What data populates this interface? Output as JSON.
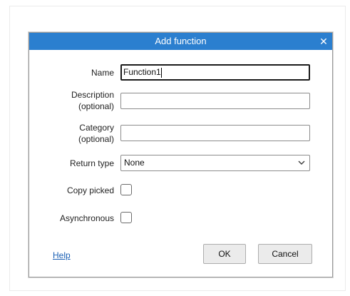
{
  "dialog": {
    "title": "Add function",
    "close_glyph": "✕"
  },
  "form": {
    "name_label": "Name",
    "name_value": "Function1",
    "description_label_line1": "Description",
    "description_label_line2": "(optional)",
    "description_value": "",
    "category_label_line1": "Category",
    "category_label_line2": "(optional)",
    "category_value": "",
    "return_type_label": "Return type",
    "return_type_value": "None",
    "copy_picked_label": "Copy picked",
    "copy_picked_checked": false,
    "asynchronous_label": "Asynchronous",
    "asynchronous_checked": false
  },
  "footer": {
    "help_label": "Help",
    "ok_label": "OK",
    "cancel_label": "Cancel"
  },
  "colors": {
    "titlebar": "#2b7fcf",
    "link": "#1a5fb4"
  },
  "icons": {
    "close": "close-icon",
    "dropdown": "chevron-down-icon"
  }
}
